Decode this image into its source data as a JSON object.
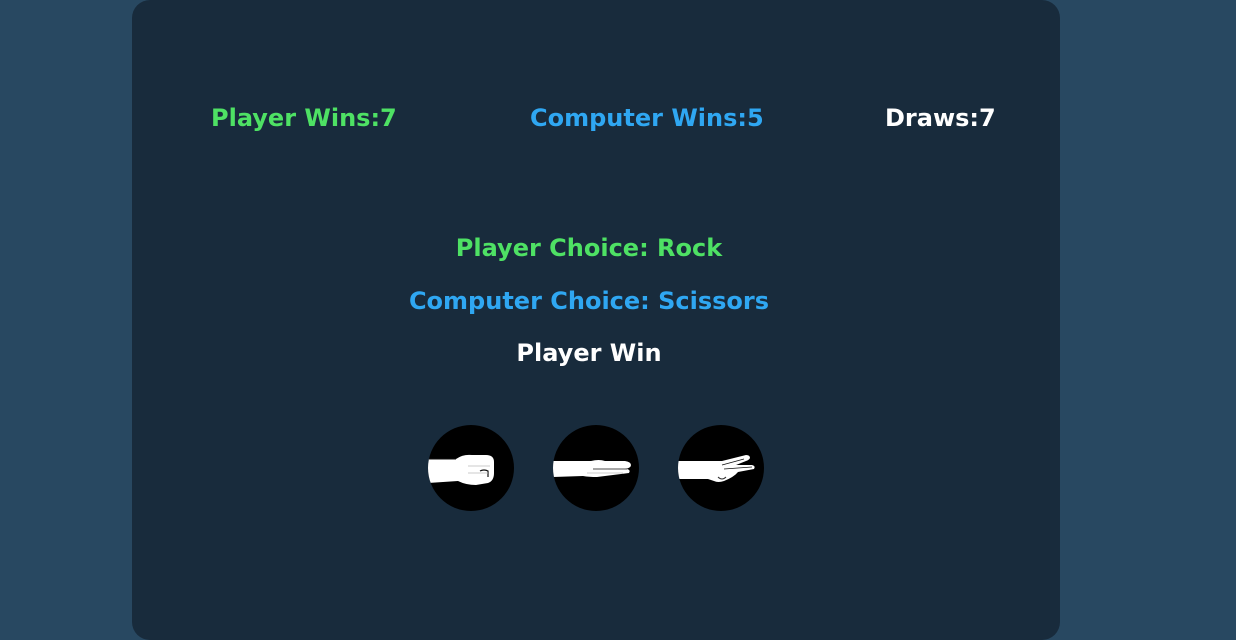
{
  "scoreboard": {
    "player_wins": "Player Wins:7",
    "computer_wins": "Computer Wins:5",
    "draws": "Draws:7"
  },
  "round": {
    "player_choice": "Player Choice: Rock",
    "computer_choice": "Computer Choice: Scissors",
    "result": "Player Win"
  },
  "choices": [
    {
      "name": "rock",
      "icon": "rock-hand-icon"
    },
    {
      "name": "paper",
      "icon": "paper-hand-icon"
    },
    {
      "name": "scissors",
      "icon": "scissors-hand-icon"
    }
  ],
  "colors": {
    "page_background": "#284861",
    "panel_background": "#182b3c",
    "player": "#4ee164",
    "computer": "#2fa7f2",
    "neutral": "#ffffff"
  }
}
